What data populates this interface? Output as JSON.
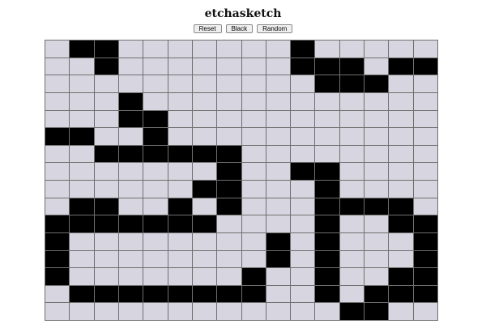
{
  "app": {
    "title": "etchasketch"
  },
  "toolbar": {
    "reset_label": "Reset",
    "black_label": "Black",
    "random_label": "Random"
  },
  "grid": {
    "columns": 16,
    "rows": 16,
    "cell_color": "#d7d6e0",
    "filled_color": "#000000",
    "grid_line_color": "#6f6f6f",
    "pattern": [
      "0110000000100000",
      "0010000000111011",
      "0000000000011100",
      "0001000000000000",
      "0001100000000000",
      "1100100000000000",
      "0011111100000000",
      "0000000100110000",
      "0000001100010000",
      "0110010100011110",
      "1111111000010011",
      "1000000001010001",
      "1000000001010001",
      "1000000010010011",
      "0111111110010111",
      "0000000000001100"
    ]
  }
}
